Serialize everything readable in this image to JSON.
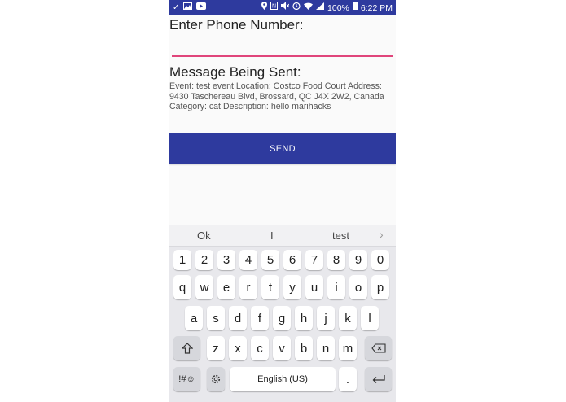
{
  "status_bar": {
    "battery": "100%",
    "time": "6:22 PM",
    "left_icons": [
      "check-icon",
      "image-icon",
      "youtube-icon"
    ],
    "right_icons": [
      "location-icon",
      "nfc-icon",
      "mute-icon",
      "alarm-icon",
      "wifi-icon",
      "signal-icon",
      "battery-icon"
    ]
  },
  "form": {
    "phone_label": "Enter Phone Number:",
    "phone_value": "",
    "message_label": "Message Being Sent:",
    "message_text": "Event: test event Location: Costco Food Court Address: 9430 Taschereau Blvd, Brossard, QC J4X 2W2, Canada Category: cat Description: hello marihacks",
    "send_label": "SEND"
  },
  "colors": {
    "accent": "#2e3a9e",
    "input_underline": "#e0457b"
  },
  "keyboard": {
    "suggestions": [
      "Ok",
      "I",
      "test"
    ],
    "number_row": [
      "1",
      "2",
      "3",
      "4",
      "5",
      "6",
      "7",
      "8",
      "9",
      "0"
    ],
    "row1": [
      "q",
      "w",
      "e",
      "r",
      "t",
      "y",
      "u",
      "i",
      "o",
      "p"
    ],
    "row2": [
      "a",
      "s",
      "d",
      "f",
      "g",
      "h",
      "j",
      "k",
      "l"
    ],
    "row3": [
      "z",
      "x",
      "c",
      "v",
      "b",
      "n",
      "m"
    ],
    "symbols_label": "!#☺",
    "space_label": "English (US)",
    "period_label": "."
  }
}
